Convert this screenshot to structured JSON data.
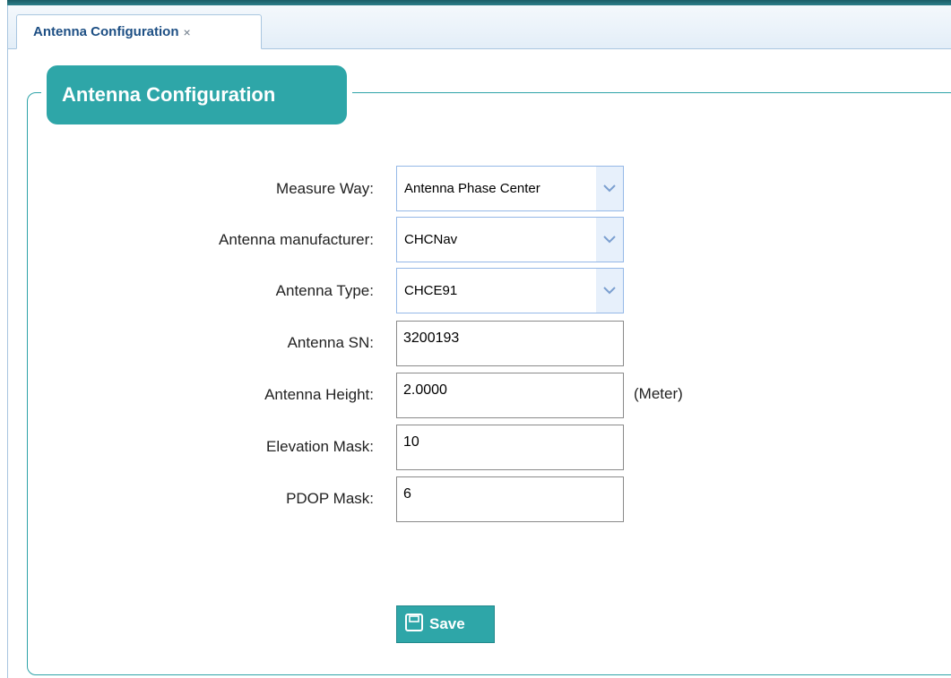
{
  "tab": {
    "title": "Antenna Configuration",
    "close_glyph": "×"
  },
  "panel": {
    "title": "Antenna Configuration"
  },
  "form": {
    "measure_way": {
      "label": "Measure Way:",
      "value": "Antenna Phase Center",
      "icon": "chevron-down-icon"
    },
    "manufacturer": {
      "label": "Antenna manufacturer:",
      "value": "CHCNav",
      "icon": "chevron-down-icon"
    },
    "antenna_type": {
      "label": "Antenna Type:",
      "value": "CHCE91",
      "icon": "chevron-down-icon"
    },
    "antenna_sn": {
      "label": "Antenna SN:",
      "value": "3200193"
    },
    "antenna_height": {
      "label": "Antenna Height:",
      "value": "2.0000",
      "unit": "(Meter)"
    },
    "elevation_mask": {
      "label": "Elevation Mask:",
      "value": "10"
    },
    "pdop_mask": {
      "label": "PDOP Mask:",
      "value": "6"
    }
  },
  "save_button": {
    "label": "Save",
    "icon": "save-icon"
  },
  "colors": {
    "accent": "#2ea6a8",
    "tab_text": "#1d4f84",
    "select_border": "#95b8e7"
  }
}
